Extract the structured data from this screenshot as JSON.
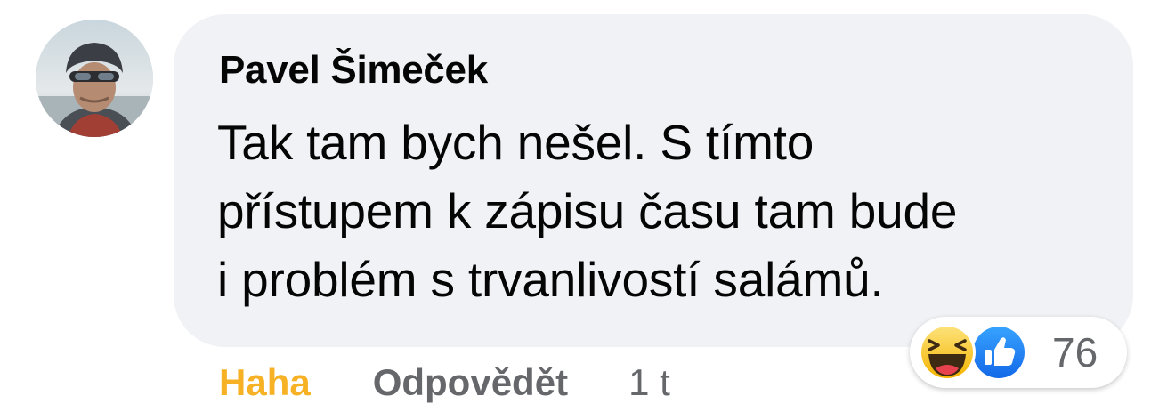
{
  "comment": {
    "author": "Pavel Šimeček",
    "text_lines": [
      "Tak tam bych nešel. S tímto",
      "přístupem k zápisu času tam bude",
      "i problém s trvanlivostí salámů."
    ],
    "avatar_icon": "profile-photo-helmet"
  },
  "actions": {
    "reaction_label": "Haha",
    "reply_label": "Odpovědět",
    "time": "1 t"
  },
  "reactions": {
    "icons": [
      "haha-emoji",
      "like-emoji"
    ],
    "count": "76"
  },
  "colors": {
    "bubble": "#f0f2f5",
    "text": "#050505",
    "muted": "#65676b",
    "haha": "#f7b125",
    "like": "#1877f2"
  }
}
